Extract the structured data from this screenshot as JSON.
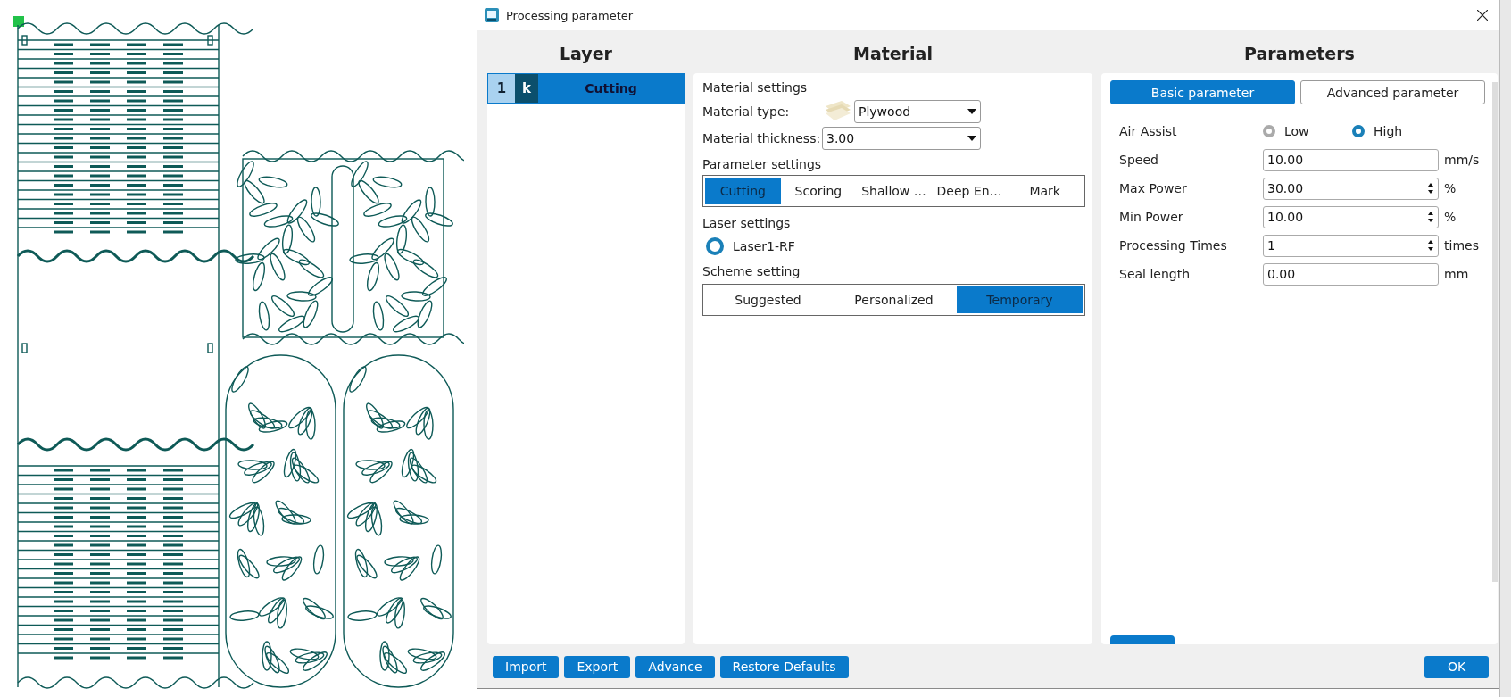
{
  "window": {
    "title": "Processing parameter"
  },
  "layer": {
    "heading": "Layer",
    "layers": [
      {
        "number": "1",
        "mode": "k",
        "name": "Cutting",
        "selected": true
      }
    ]
  },
  "material": {
    "heading": "Material",
    "section": "Material settings",
    "type_label": "Material type:",
    "type_value": "Plywood",
    "thickness_label": "Material thickness:",
    "thickness_value": "3.00",
    "parameter_heading": "Parameter settings",
    "modes": [
      {
        "label": "Cutting",
        "selected": true
      },
      {
        "label": "Scoring",
        "selected": false
      },
      {
        "label": "Shallow …",
        "selected": false
      },
      {
        "label": "Deep En…",
        "selected": false
      },
      {
        "label": "Mark",
        "selected": false
      }
    ],
    "laser_heading": "Laser settings",
    "lasers": [
      {
        "label": "Laser1-RF",
        "selected": true
      }
    ],
    "scheme_heading": "Scheme setting",
    "schemes": [
      {
        "label": "Suggested",
        "selected": false
      },
      {
        "label": "Personalized",
        "selected": false
      },
      {
        "label": "Temporary",
        "selected": true
      }
    ]
  },
  "parameters": {
    "heading": "Parameters",
    "tabs": [
      {
        "label": "Basic parameter",
        "selected": true
      },
      {
        "label": "Advanced parameter",
        "selected": false
      }
    ],
    "air_assist": {
      "label": "Air Assist",
      "options": [
        {
          "label": "Low",
          "selected": false
        },
        {
          "label": "High",
          "selected": true
        }
      ]
    },
    "fields": [
      {
        "label": "Speed",
        "value": "10.00",
        "unit": "mm/s",
        "kind": "text"
      },
      {
        "label": "Max Power",
        "value": "30.00",
        "unit": "%",
        "kind": "spin"
      },
      {
        "label": "Min Power",
        "value": "10.00",
        "unit": "%",
        "kind": "spin"
      },
      {
        "label": "Processing Times",
        "value": "1",
        "unit": "times",
        "kind": "spin"
      },
      {
        "label": "Seal length",
        "value": "0.00",
        "unit": "mm",
        "kind": "text"
      }
    ]
  },
  "buttons": [
    {
      "label": "Import"
    },
    {
      "label": "Export"
    },
    {
      "label": "Advance"
    },
    {
      "label": "Restore Defaults"
    }
  ],
  "ok": {
    "label": "OK"
  }
}
